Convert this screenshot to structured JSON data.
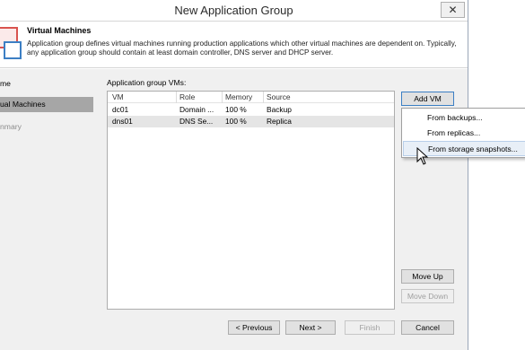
{
  "window": {
    "title": "New Application Group",
    "close_glyph": "✕"
  },
  "header": {
    "title": "Virtual Machines",
    "description": "Application group defines virtual machines running production applications which other virtual machines are dependent on. Typically, any application group should contain at least domain controller, DNS server and DHCP server."
  },
  "nav": {
    "items": [
      {
        "label": "me",
        "state": "normal"
      },
      {
        "label": "ual Machines",
        "state": "active"
      },
      {
        "label": "nmary",
        "state": "disabled"
      }
    ]
  },
  "vm_section": {
    "label": "Application group VMs:",
    "columns": [
      "VM",
      "Role",
      "Memory",
      "Source"
    ],
    "rows": [
      {
        "vm": "dc01",
        "role": "Domain ...",
        "memory": "100 %",
        "source": "Backup"
      },
      {
        "vm": "dns01",
        "role": "DNS Se...",
        "memory": "100 %",
        "source": "Replica"
      }
    ]
  },
  "buttons": {
    "add_vm": "Add VM",
    "move_up": "Move Up",
    "move_down": "Move Down"
  },
  "add_vm_menu": {
    "items": [
      "From backups...",
      "From replicas...",
      "From storage snapshots..."
    ]
  },
  "footer": {
    "previous": "< Previous",
    "next": "Next >",
    "finish": "Finish",
    "cancel": "Cancel"
  },
  "colors": {
    "accent": "#3c7fc4",
    "selection": "#a6a6a6",
    "menu_hover": "#e8eff7"
  }
}
